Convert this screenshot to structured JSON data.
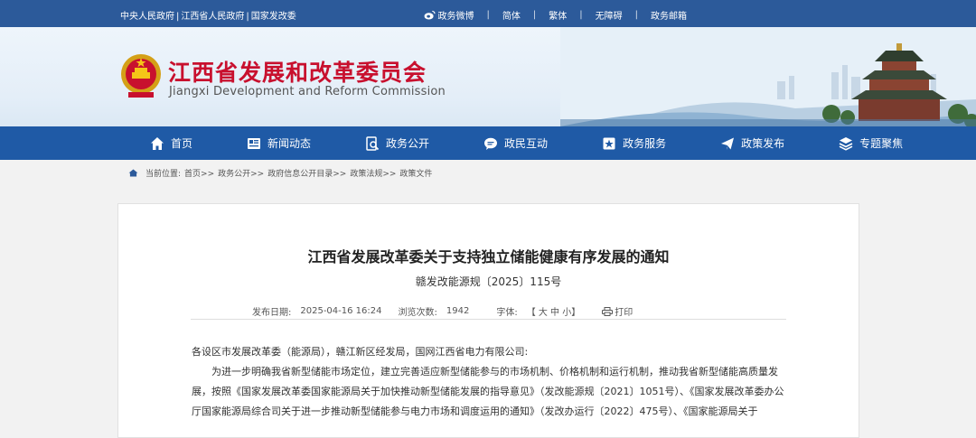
{
  "topbar": {
    "links": [
      "中央人民政府",
      "江西省人民政府",
      "国家发改委"
    ],
    "right": [
      "政务微博",
      "简体",
      "繁体",
      "无障碍",
      "政务邮箱"
    ]
  },
  "header": {
    "title_cn": "江西省发展和改革委员会",
    "title_en": "Jiangxi Development and Reform Commission"
  },
  "nav": {
    "items": [
      {
        "label": "首页",
        "icon": "home-icon"
      },
      {
        "label": "新闻动态",
        "icon": "news-icon"
      },
      {
        "label": "政务公开",
        "icon": "document-search-icon"
      },
      {
        "label": "政民互动",
        "icon": "chat-icon"
      },
      {
        "label": "政务服务",
        "icon": "service-icon"
      },
      {
        "label": "政策发布",
        "icon": "send-icon"
      },
      {
        "label": "专题聚焦",
        "icon": "layers-icon"
      }
    ]
  },
  "breadcrumb": {
    "prefix": "当前位置:",
    "items": [
      "首页>>",
      "政务公开>>",
      "政府信息公开目录>>",
      "政策法规>>",
      "政策文件"
    ]
  },
  "article": {
    "title": "江西省发展改革委关于支持独立储能健康有序发展的通知",
    "doc_number": "赣发改能源规〔2025〕115号",
    "publish_label": "发布日期:",
    "publish_date": "2025-04-16 16:24",
    "views_label": "浏览次数:",
    "views": "1942",
    "font_label": "字体:",
    "font_options": "【 大 中 小】",
    "print_label": "打印",
    "salutation": "各设区市发展改革委（能源局），赣江新区经发局，国网江西省电力有限公司:",
    "paragraph": "为进一步明确我省新型储能市场定位，建立完善适应新型储能参与的市场机制、价格机制和运行机制，推动我省新型储能高质量发展，按照《国家发展改革委国家能源局关于加快推动新型储能发展的指导意见》（发改能源规〔2021〕1051号）、《国家发展改革委办公厅国家能源局综合司关于进一步推动新型储能参与电力市场和调度运用的通知》（发改办运行〔2022〕475号）、《国家能源局关于"
  }
}
